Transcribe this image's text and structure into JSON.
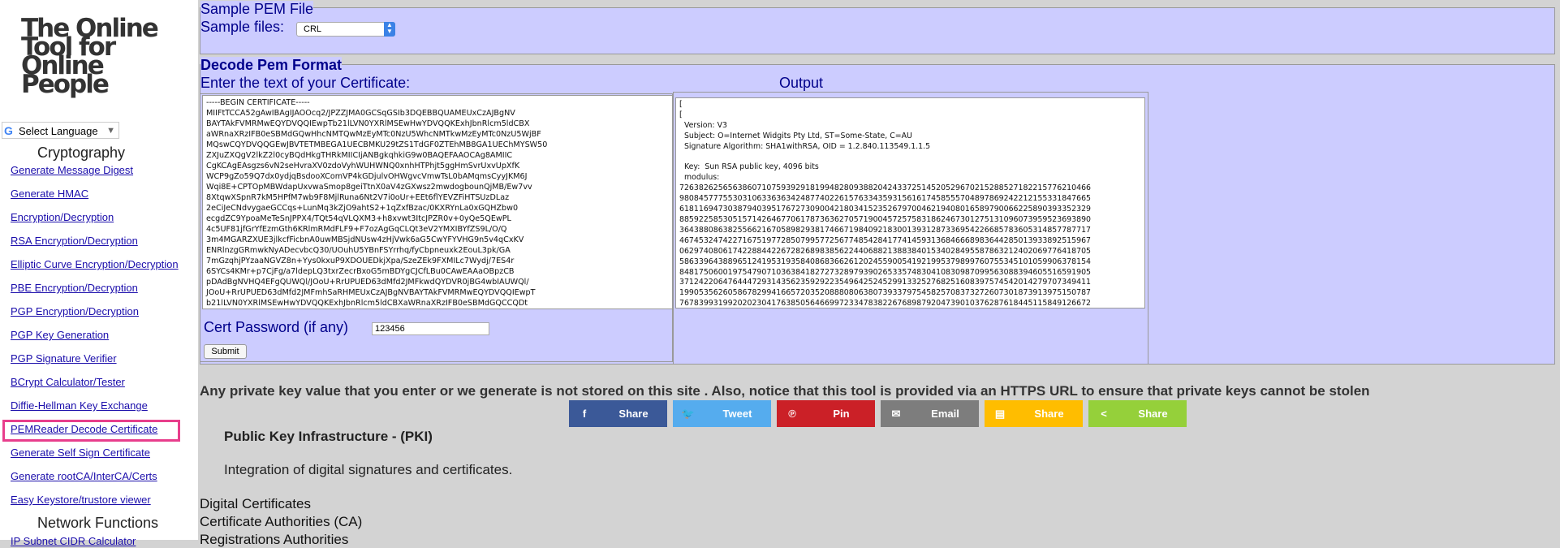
{
  "logo": {
    "line1": "The Online",
    "line2": "Tool for",
    "line3": "Online",
    "line4": "People"
  },
  "translate": {
    "label": "Select Language",
    "brand": "G"
  },
  "sidebar": {
    "section_crypto": "Cryptography",
    "items": [
      {
        "label": "Generate Message Digest"
      },
      {
        "label": "Generate HMAC"
      },
      {
        "label": "Encryption/Decryption"
      },
      {
        "label": "RSA Encryption/Decryption"
      },
      {
        "label": "Elliptic Curve Encryption/Decryption"
      },
      {
        "label": "PBE Encryption/Decryption"
      },
      {
        "label": "PGP Encryption/Decryption"
      },
      {
        "label": "PGP Key Generation"
      },
      {
        "label": "PGP Signature Verifier"
      },
      {
        "label": "BCrypt Calculator/Tester"
      },
      {
        "label": "Diffie-Hellman Key Exchange"
      },
      {
        "label": "PEMReader Decode Certificate",
        "active": true
      },
      {
        "label": "Generate Self Sign Certificate"
      },
      {
        "label": "Generate rootCA/InterCA/Certs"
      },
      {
        "label": "Easy Keystore/trustore viewer"
      }
    ],
    "section_network": "Network Functions",
    "partial_item": "IP Subnet CIDR Calculator"
  },
  "sample": {
    "legend": "Sample PEM File",
    "label": "Sample files:",
    "selected": "CRL"
  },
  "decode": {
    "legend": "Decode Pem Format",
    "input_label": "Enter the text of your Certificate:",
    "output_label": "Output",
    "cert_text": "-----BEGIN CERTIFICATE-----\nMIIFtTCCA52gAwIBAgIJAOOcq2/JPZZJMA0GCSqGSIb3DQEBBQUAMEUxCzAJBgNV\nBAYTAkFVMRMwEQYDVQQIEwpTb21lLVN0YXRlMSEwHwYDVQQKExhJbnRlcm5ldCBX\naWRnaXRzIFB0eSBMdGQwHhcNMTQwMzEyMTc0NzU5WhcNMTkwMzEyMTc0NzU5WjBF\nMQswCQYDVQQGEwJBVTETMBEGA1UECBMKU29tZS1TdGF0ZTEhMB8GA1UEChMYSW50\nZXJuZXQgV2lkZ2l0cyBQdHkgTHRkMIICIjANBgkqhkiG9w0BAQEFAAOCAg8AMIIC\nCgKCAgEAsgzs6vN2seHvraXV0zdoVyhWUHWNQ0xnhHTPhjt5ggHmSvrUxvUpXfK\nWCP9gZo59Q7dx0ydjqBsdooXComVP4kGDjulvOHWgvcVmwTsL0bAMqmsCyyJKM6J\nWqi8E+CPTOpMBWdapUxvwaSmop8geiTtnX0aV4zGXwsz2mwdogbounQjMB/Ew7vv\n8XtqwXSpnR7kM5HPfM7wb9F8MjlRuna6Nt2V7i0oUr+EEt6flYEVZFiHTSUzDLaz\n2eCiJeCNdvygaeGCCqs+LunMq3kZjO9ahtS2+1qZxfBzac/0KXRYnLa0xGQHZbw0\necgdZC9YpoaMeTeSnJPPX4/TQt54qVLQXM3+h8xvwt3ItcJPZR0v+0yQe5QEwPL\n4c5UF81jfGrYfEzmGth6KRlmRMdFLF9+F7ozAgGqCLQt3eV2YMXIBYfZS9L/O/Q\n3m4MGARZXUE3jlkcfFicbnA0uwMBSjdNUsw4zHjVwk6aG5CwYFYVHG9n5v4qCxKV\nENRlnzgGRmwkNyADecvbcQ30/UOuhU5YBnFSYrrhq/fyCbpneuxk2EouL3pk/GA\n7mGzqhjPYzaaNGVZ8n+Yys0kxuP9XDOUEDkjXpa/SzeZEk9FXMILc7Wydj/7ES4r\n6SYCs4KMr+p7CjFg/a7ldepLQ3txrZecrBxoG5mBDYgCJCfLBu0CAwEAAaOBpzCB\npDAdBgNVHQ4EFgQUWQl/JOoU+RrUPUED63dMfd2JMFkwdQYDVR0jBG4wbIAUWQl/\nJOoU+RrUPUED63dMfd2JMFmhSaRHMEUxCzAJBgNVBAYTAkFVMRMwEQYDVQQIEwpT\nb21lLVN0YXRlMSEwHwYDVQQKExhJbnRlcm5ldCBXaWRnaXRzIFB0eSBMdGQCCQDt",
    "output_text": "[\n[\n  Version: V3\n  Subject: O=Internet Widgits Pty Ltd, ST=Some-State, C=AU\n  Signature Algorithm: SHA1withRSA, OID = 1.2.840.113549.1.1.5\n\n  Key:  Sun RSA public key, 4096 bits\n  modulus:\n7263826256563860710759392918199482809388204243372514520529670215288527182215776210466\n9808457775530310633636342487740226157633435931561617458555704897869242212155331847665\n6181169473038794039517672730900421803415235267970046219408016589790066225890393352329\n8859225853051571426467706178736362705719004572575831862467301275131096073959523693890\n3643880863825566216705898293817466719840921830013931287336954226685783605314857787717\n4674532474227167519772850799577256774854284177414593136846668983644285013933892515967\n0629740806174228844226728268983856224406882138838401534028495587863212402069776418705\n5863396438896512419531935840868366261202455900541921995379899760755345101059906378154\n8481750600197547907103638418272732897939026533574830410830987099563088394605516591905\n3712422064764447293143562359292235496425245299133252768251608397574542014279707349411\n1990535626058678299416657203520888080638073933797545825708373272607301873913975150787\n7678399319920202304176385056466997233478382267689879204739010376287618445115849126672",
    "pwd_label": "Cert Password (if any)",
    "pwd_value": "123456",
    "submit_label": "Submit"
  },
  "notice": "Any private key value that you enter or we generate is not stored on this site . Also, notice that this tool is provided via an HTTPS URL to ensure that private keys cannot be stolen",
  "share_buttons": [
    {
      "label": "Share",
      "icon": "facebook-icon",
      "glyph": "f",
      "color": "#3b5998"
    },
    {
      "label": "Tweet",
      "icon": "twitter-icon",
      "glyph": "🐦",
      "color": "#55acee"
    },
    {
      "label": "Pin",
      "icon": "pinterest-icon",
      "glyph": "℗",
      "color": "#cb2027"
    },
    {
      "label": "Email",
      "icon": "email-icon",
      "glyph": "✉",
      "color": "#7d7d7d"
    },
    {
      "label": "Share",
      "icon": "sms-icon",
      "glyph": "▤",
      "color": "#ffbd00"
    },
    {
      "label": "Share",
      "icon": "share-icon",
      "glyph": "<",
      "color": "#95d03a"
    }
  ],
  "pki": {
    "title": "Public Key Infrastructure - (PKI)",
    "desc": "Integration of digital signatures and certificates."
  },
  "bottom_list": [
    "Digital Certificates",
    "Certificate Authorities (CA)",
    "Registrations Authorities"
  ]
}
